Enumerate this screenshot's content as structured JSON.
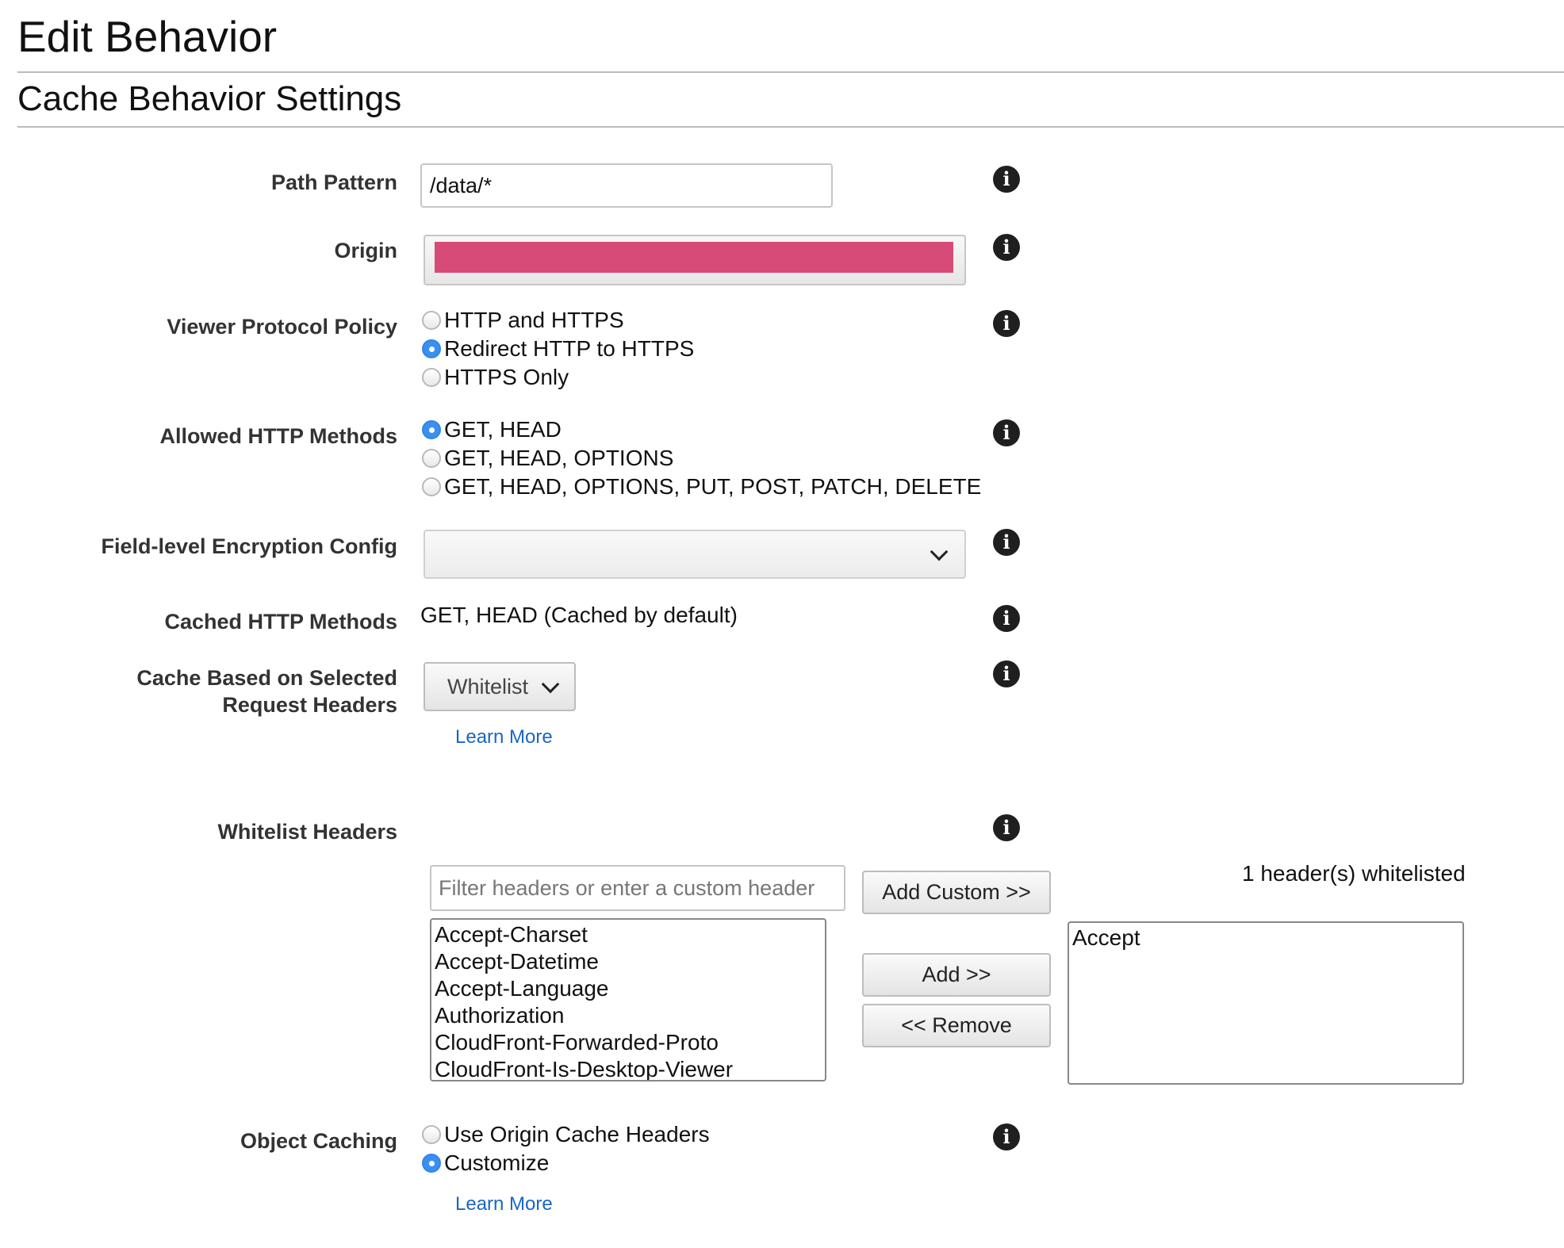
{
  "page": {
    "title": "Edit Behavior",
    "section_title": "Cache Behavior Settings"
  },
  "path_pattern": {
    "label": "Path Pattern",
    "value": "/data/*"
  },
  "origin": {
    "label": "Origin",
    "value_redacted": true,
    "redaction_color": "#d64b78"
  },
  "viewer_protocol_policy": {
    "label": "Viewer Protocol Policy",
    "options": [
      "HTTP and HTTPS",
      "Redirect HTTP to HTTPS",
      "HTTPS Only"
    ],
    "selected_index": 1
  },
  "allowed_http_methods": {
    "label": "Allowed HTTP Methods",
    "options": [
      "GET, HEAD",
      "GET, HEAD, OPTIONS",
      "GET, HEAD, OPTIONS, PUT, POST, PATCH, DELETE"
    ],
    "selected_index": 0
  },
  "field_level_encryption": {
    "label": "Field-level Encryption Config",
    "selected_value": ""
  },
  "cached_http_methods": {
    "label": "Cached HTTP Methods",
    "value": "GET, HEAD (Cached by default)"
  },
  "cache_headers": {
    "label_line1": "Cache Based on Selected",
    "label_line2": "Request Headers",
    "selected_value": "Whitelist",
    "learn_more": "Learn More"
  },
  "whitelist_headers": {
    "label": "Whitelist Headers",
    "filter_placeholder": "Filter headers or enter a custom header",
    "add_custom_label": "Add Custom >>",
    "add_label": "Add >>",
    "remove_label": "<< Remove",
    "count_text": "1 header(s) whitelisted",
    "available": [
      "Accept-Charset",
      "Accept-Datetime",
      "Accept-Language",
      "Authorization",
      "CloudFront-Forwarded-Proto",
      "CloudFront-Is-Desktop-Viewer"
    ],
    "selected": [
      "Accept"
    ]
  },
  "object_caching": {
    "label": "Object Caching",
    "options": [
      "Use Origin Cache Headers",
      "Customize"
    ],
    "selected_index": 1,
    "learn_more": "Learn More"
  },
  "colors": {
    "accent": "#3b8ff0",
    "link": "#1a66c6"
  },
  "icons": {
    "info": "info-icon",
    "chevron": "chevron-down-icon"
  }
}
